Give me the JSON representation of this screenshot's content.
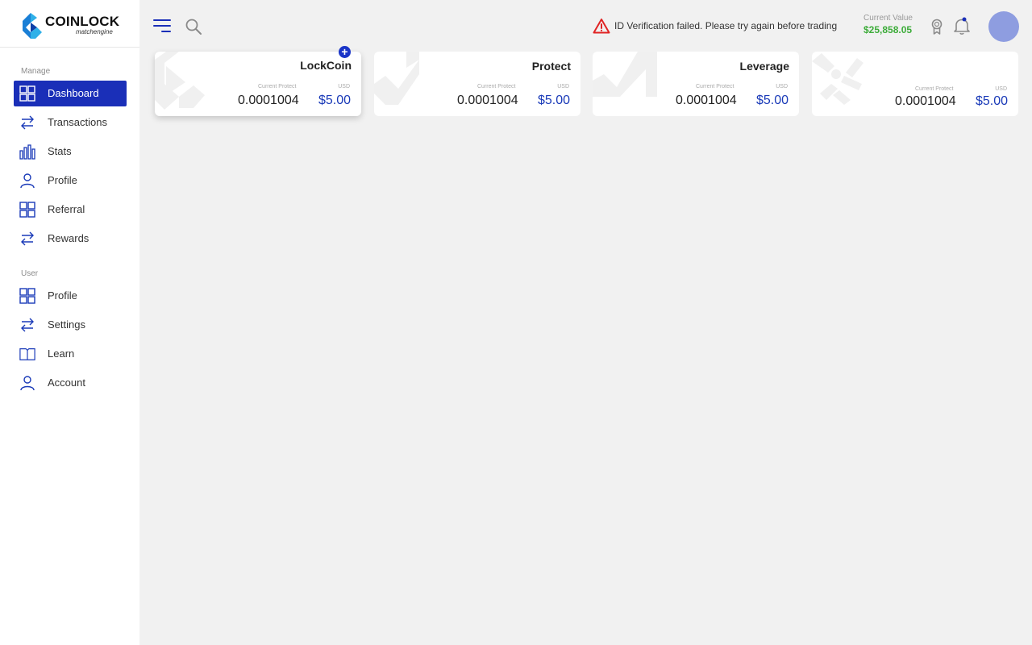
{
  "brand": {
    "name": "COINLOCK",
    "tagline": "matchengine"
  },
  "sidebar": {
    "manage_label": "Manage",
    "manage_items": [
      {
        "label": "Dashboard",
        "icon": "grid-icon",
        "active": true
      },
      {
        "label": "Transactions",
        "icon": "arrows-swap-icon"
      },
      {
        "label": "Stats",
        "icon": "bar-chart-icon"
      },
      {
        "label": "Profile",
        "icon": "user-icon"
      },
      {
        "label": "Referral",
        "icon": "grid-icon"
      },
      {
        "label": "Rewards",
        "icon": "arrows-swap-icon"
      }
    ],
    "user_label": "User",
    "user_items": [
      {
        "label": "Profile",
        "icon": "grid-icon"
      },
      {
        "label": "Settings",
        "icon": "arrows-swap-icon"
      },
      {
        "label": "Learn",
        "icon": "book-icon"
      },
      {
        "label": "Account",
        "icon": "user-icon"
      }
    ]
  },
  "header": {
    "alert_text": "ID Verification failed. Please try again before trading",
    "current_value_label": "Current Value",
    "current_value": "$25,858.05"
  },
  "cards": [
    {
      "title": "LockCoin",
      "cp_label": "Current Protect",
      "usd_label": "USD",
      "amount": "0.0001004",
      "price": "$5.00"
    },
    {
      "title": "Protect",
      "cp_label": "Current Protect",
      "usd_label": "USD",
      "amount": "0.0001004",
      "price": "$5.00"
    },
    {
      "title": "Leverage",
      "cp_label": "Current Protect",
      "usd_label": "USD",
      "amount": "0.0001004",
      "price": "$5.00"
    },
    {
      "title": "",
      "cp_label": "Current Protect",
      "usd_label": "USD",
      "amount": "0.0001004",
      "price": "$5.00"
    }
  ],
  "colors": {
    "accent": "#1a2fb8",
    "positive": "#3dac3a",
    "alert": "#e02424",
    "avatar": "#8e9de0",
    "background": "#f1f1f1"
  }
}
